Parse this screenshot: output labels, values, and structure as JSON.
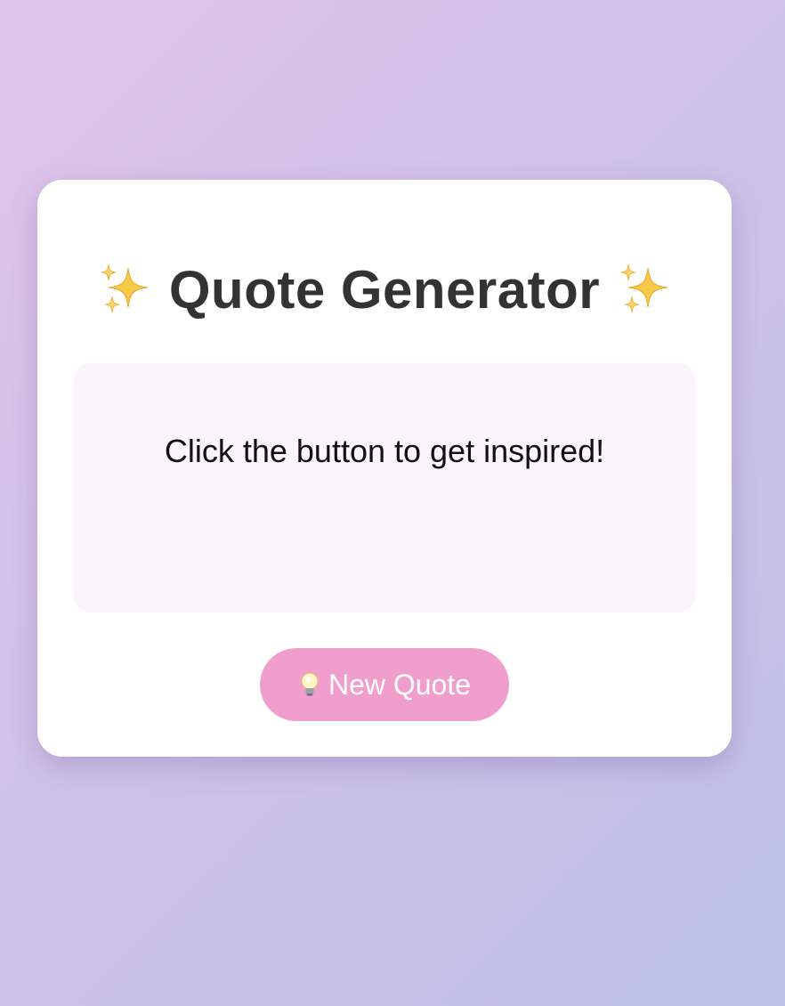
{
  "app": {
    "title": "Quote Generator",
    "title_icon_left": "sparkles-icon",
    "title_icon_right": "sparkles-icon"
  },
  "quote": {
    "text": "Click the button to get inspired!"
  },
  "actions": {
    "new_quote_label": "New Quote",
    "new_quote_icon": "lightbulb-icon"
  },
  "colors": {
    "background_gradient": [
      "#e0c3e8",
      "#bcc0e6"
    ],
    "card": "#ffffff",
    "title": "#333333",
    "quote_box": "#fcf4fd",
    "button": "#f09ecb",
    "button_text": "#ffffff",
    "sparkle": "#f7c948"
  }
}
